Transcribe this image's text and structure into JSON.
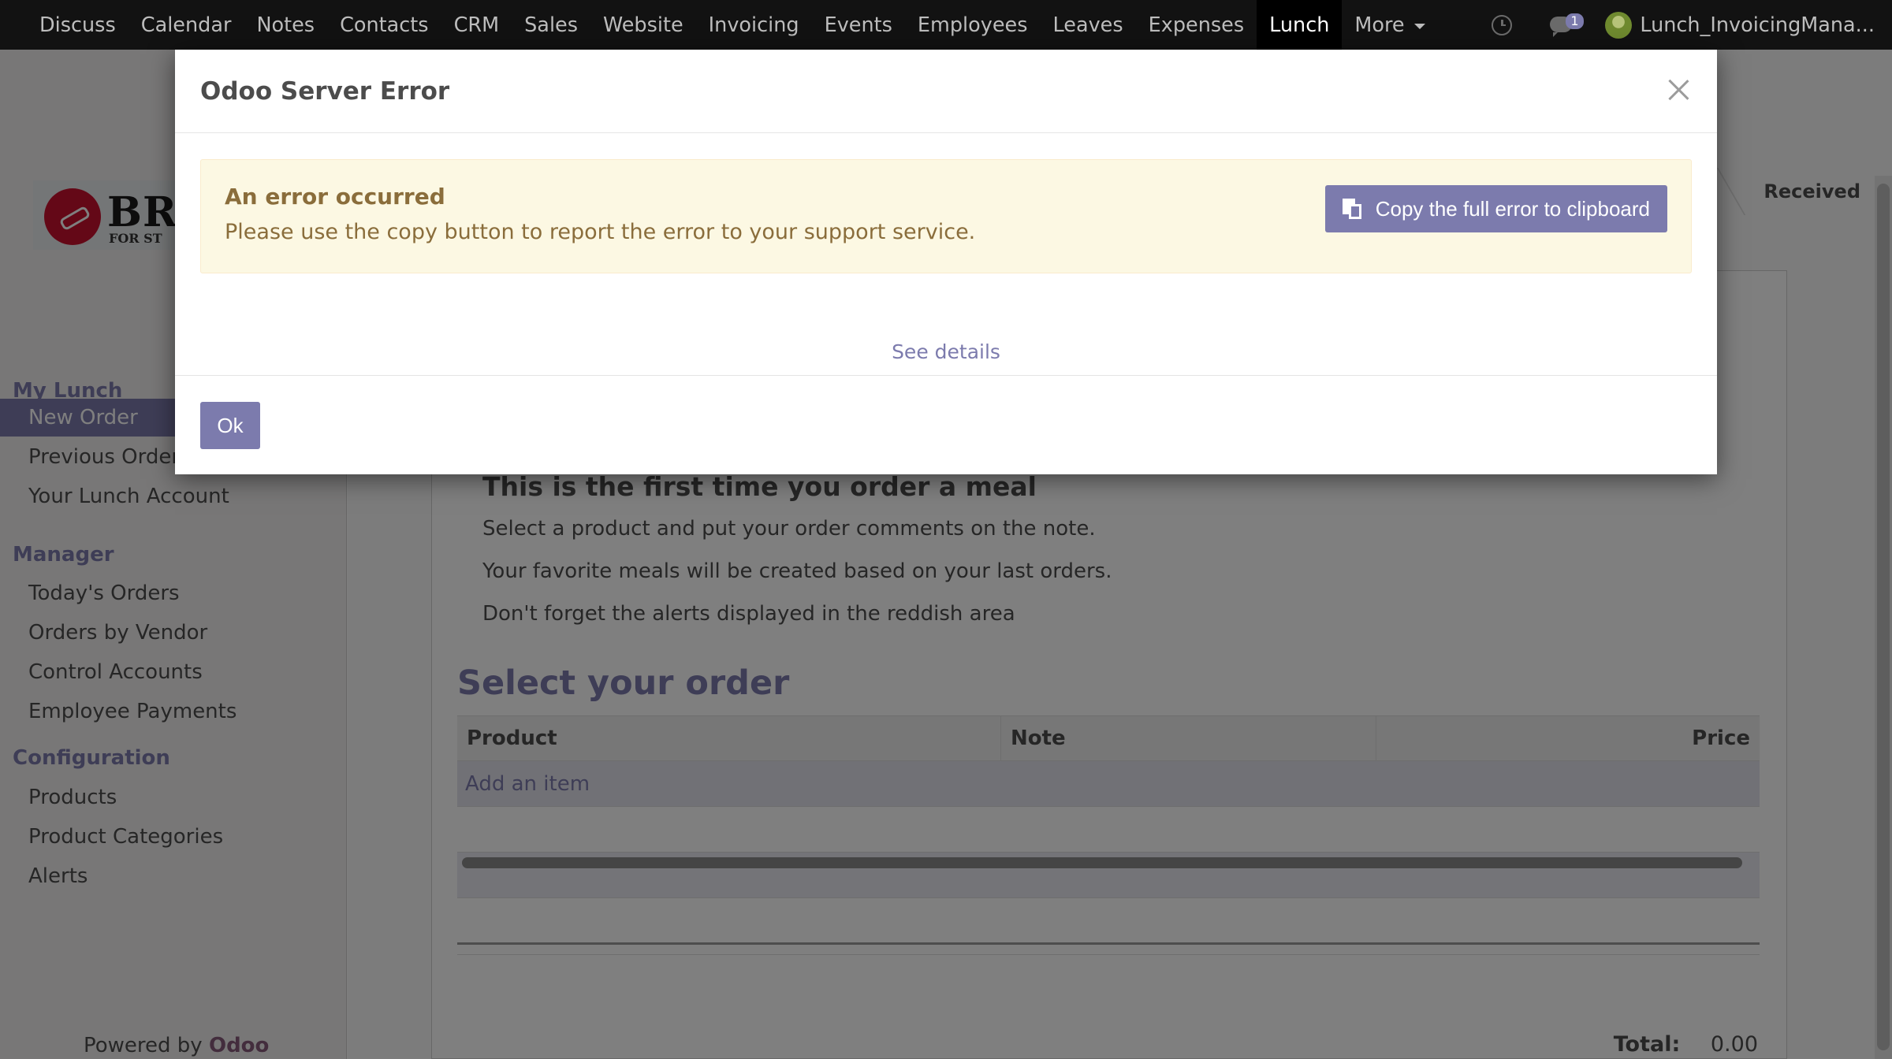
{
  "topbar": {
    "menu": [
      {
        "label": "Discuss",
        "active": false
      },
      {
        "label": "Calendar",
        "active": false
      },
      {
        "label": "Notes",
        "active": false
      },
      {
        "label": "Contacts",
        "active": false
      },
      {
        "label": "CRM",
        "active": false
      },
      {
        "label": "Sales",
        "active": false
      },
      {
        "label": "Website",
        "active": false
      },
      {
        "label": "Invoicing",
        "active": false
      },
      {
        "label": "Events",
        "active": false
      },
      {
        "label": "Employees",
        "active": false
      },
      {
        "label": "Leaves",
        "active": false
      },
      {
        "label": "Expenses",
        "active": false
      },
      {
        "label": "Lunch",
        "active": true
      },
      {
        "label": "More",
        "active": false
      }
    ],
    "chat_badge": "1",
    "user_name": "Lunch_InvoicingMana..."
  },
  "sidebar": {
    "logo_text": "BRI",
    "logo_subtext": "FOR ST",
    "sections": [
      {
        "title": "My Lunch",
        "items": [
          "New Order",
          "Previous Orders",
          "Your Lunch Account"
        ]
      },
      {
        "title": "Manager",
        "items": [
          "Today's Orders",
          "Orders by Vendor",
          "Control Accounts",
          "Employee Payments"
        ]
      },
      {
        "title": "Configuration",
        "items": [
          "Products",
          "Product Categories",
          "Alerts"
        ]
      }
    ],
    "active_item": "New Order",
    "powered_by": "Powered by",
    "powered_brand": "Odoo"
  },
  "main": {
    "status": "Received",
    "first_time_heading": "This is the first time you order a meal",
    "paragraphs": [
      "Select a product and put your order comments on the note.",
      "Your favorite meals will be created based on your last orders.",
      "Don't forget the alerts displayed in the reddish area"
    ],
    "select_heading": "Select your order",
    "table": {
      "columns": [
        "Product",
        "Note",
        "Price"
      ],
      "add_item": "Add an item"
    },
    "total_label": "Total:",
    "total_value": "0.00"
  },
  "modal": {
    "title": "Odoo Server Error",
    "alert_title": "An error occurred",
    "alert_text": "Please use the copy button to report the error to your support service.",
    "copy_button": "Copy the full error to clipboard",
    "see_details": "See details",
    "ok_button": "Ok"
  },
  "colors": {
    "accent": "#7c7bad",
    "topbar": "#121212",
    "alert_bg": "#fcf8e3",
    "alert_text": "#8a6d3b",
    "brand": "#875a7b"
  }
}
